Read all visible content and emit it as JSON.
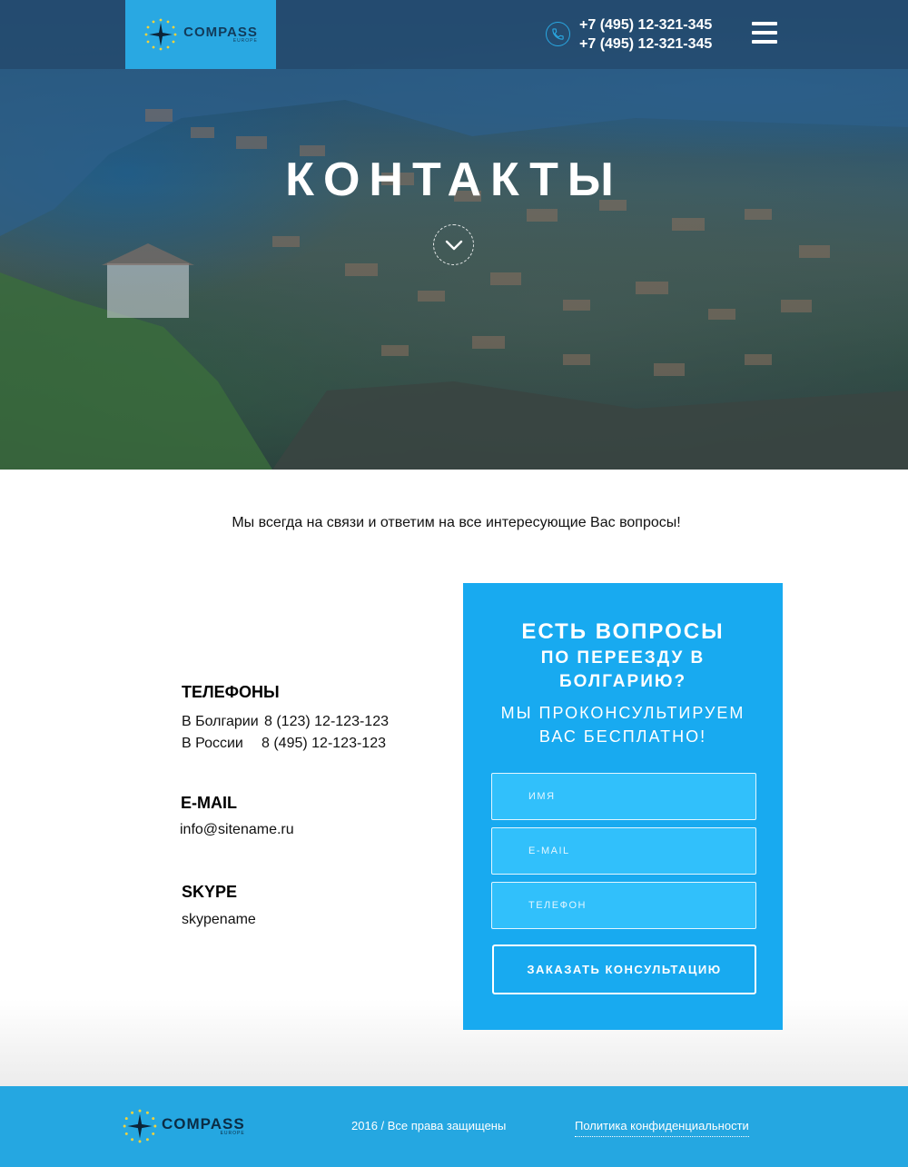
{
  "header": {
    "logo": {
      "name": "COMPASS",
      "sub": "EUROPE"
    },
    "phones": [
      "+7 (495) 12-321-345",
      "+7 (495) 12-321-345"
    ],
    "icons": {
      "phone": "phone-icon",
      "menu": "menu-icon"
    }
  },
  "hero": {
    "title": "КОНТАКТЫ",
    "scroll_icon": "chevron-down-icon"
  },
  "intro": "Мы всегда на связи и ответим на все интересующие Вас вопросы!",
  "contacts": {
    "phones": {
      "title": "ТЕЛЕФОНЫ",
      "lines": [
        {
          "label": "В Болгарии",
          "value": "8 (123) 12-123-123"
        },
        {
          "label": "В России",
          "value": "8 (495) 12-123-123"
        }
      ]
    },
    "email": {
      "title": "E-MAIL",
      "value": "info@sitename.ru"
    },
    "skype": {
      "title": "SKYPE",
      "value": "skypename"
    }
  },
  "form": {
    "title": "ЕСТЬ ВОПРОСЫ",
    "subtitle_line1": "ПО ПЕРЕЕЗДУ В",
    "subtitle_line2": "БОЛГАРИЮ?",
    "offer_line1": "МЫ ПРОКОНСУЛЬТИРУЕМ",
    "offer_line2": "ВАС БЕСПЛАТНО!",
    "fields": {
      "name_placeholder": "ИМЯ",
      "email_placeholder": "E-MAIL",
      "phone_placeholder": "ТЕЛЕФОН"
    },
    "submit_label": "ЗАКАЗАТЬ КОНСУЛЬТАЦИЮ"
  },
  "footer": {
    "logo": {
      "name": "COMPASS",
      "sub": "EUROPE"
    },
    "copyright": "2016 / Все права защищены",
    "policy_link": "Политика конфиденциальности"
  },
  "colors": {
    "accent": "#18aaf0",
    "field_bg": "#31c0fb",
    "footer_bg": "#25a7e1",
    "logo_box": "#29a8e2"
  }
}
